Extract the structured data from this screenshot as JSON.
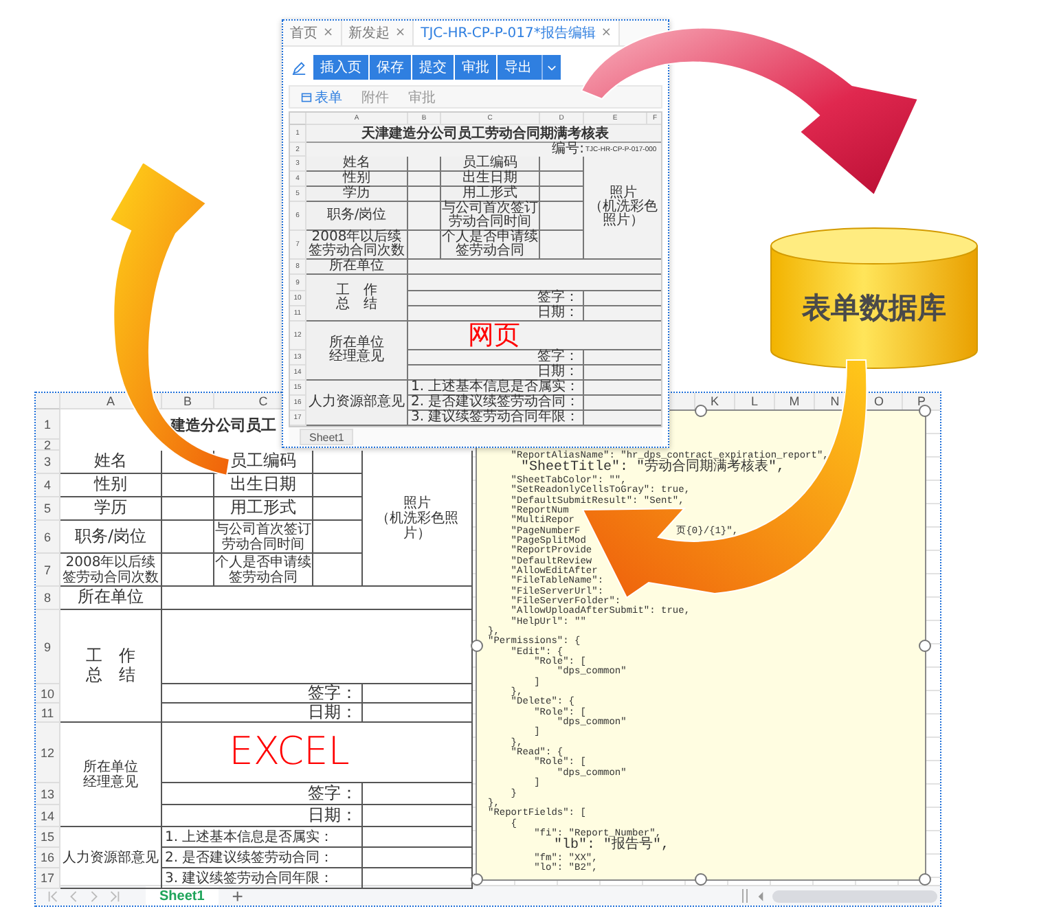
{
  "web_page": {
    "tabs": [
      {
        "label": "首页",
        "close": "×",
        "selected": false
      },
      {
        "label": "新发起",
        "close": "×",
        "selected": false
      },
      {
        "label": "TJC-HR-CP-P-017*报告编辑",
        "close": "×",
        "selected": true
      }
    ],
    "toolbar": [
      {
        "label": "插入页",
        "dropdown": false
      },
      {
        "label": "保存",
        "dropdown": false
      },
      {
        "label": "提交",
        "dropdown": false
      },
      {
        "label": "审批",
        "dropdown": false
      },
      {
        "label": "导出",
        "dropdown": true
      }
    ],
    "subtabs": [
      {
        "label": "表单",
        "selected": true
      },
      {
        "label": "附件",
        "selected": false
      },
      {
        "label": "审批",
        "selected": false
      }
    ],
    "columns": [
      "A",
      "B",
      "C",
      "D",
      "E",
      "F"
    ],
    "row_numbers": [
      "1",
      "2",
      "3",
      "4",
      "5",
      "6",
      "7",
      "8",
      "9",
      "10",
      "11",
      "12",
      "13",
      "14",
      "15",
      "16",
      "17"
    ],
    "form": {
      "title": "天津建造分公司员工劳动合同期满考核表",
      "number_label": "编号:",
      "number": "TJC-HR-CP-P-017-000",
      "photo_lines": [
        "照片",
        "（机洗彩色照片）"
      ],
      "info_rows": [
        {
          "label": "姓名",
          "label2": "员工编码"
        },
        {
          "label": "性别",
          "label2": "出生日期"
        },
        {
          "label": "学历",
          "label2": "用工形式"
        },
        {
          "label": "职务/岗位",
          "label2": "与公司首次签订劳动合同时间"
        },
        {
          "label": "2008年以后续签劳动合同次数",
          "label2": "个人是否申请续签劳动合同"
        }
      ],
      "unit": "所在单位",
      "sections": [
        {
          "label_lines": [
            "工　作",
            "总　结"
          ],
          "sign": "签字：",
          "date": "日期："
        },
        {
          "label_lines": [
            "所在单位",
            "经理意见"
          ],
          "sign": "签字：",
          "date": "日期："
        }
      ],
      "hr": {
        "label": "人力资源部意见",
        "items": [
          "1. 上述基本信息是否属实：",
          "2. 是否建议续签劳动合同：",
          "3. 建议续签劳动合同年限："
        ]
      }
    },
    "overlay_label": "网页",
    "sheet_tabs": [
      {
        "label": "Sheet1"
      }
    ]
  },
  "database": {
    "label": "表单数据库"
  },
  "excel": {
    "columns": [
      "A",
      "B",
      "C"
    ],
    "right_columns": [
      "K",
      "L",
      "M",
      "N",
      "O",
      "P"
    ],
    "row_numbers": [
      "1",
      "2",
      "3",
      "4",
      "5",
      "6",
      "7",
      "8",
      "9",
      "10",
      "11",
      "12",
      "13",
      "14",
      "15",
      "16",
      "17"
    ],
    "form": {
      "title": "建造分公司员工",
      "photo_lines": [
        "照片",
        "（机洗彩色照片）"
      ],
      "info_rows": [
        {
          "label": "姓名",
          "label2": "员工编码"
        },
        {
          "label": "性别",
          "label2": "出生日期"
        },
        {
          "label": "学历",
          "label2": "用工形式"
        },
        {
          "label": "职务/岗位",
          "label2": "与公司首次签订劳动合同时间"
        },
        {
          "label": "2008年以后续签劳动合同次数",
          "label2": "个人是否申请续签劳动合同"
        }
      ],
      "unit": "所在单位",
      "sections": [
        {
          "label_lines": [
            "工　作",
            "总　结"
          ],
          "sign": "签字：",
          "date": "日期："
        },
        {
          "label_lines": [
            "所在单位",
            "经理意见"
          ],
          "sign": "签字：",
          "date": "日期："
        }
      ],
      "hr": {
        "label": "人力资源部意见",
        "items": [
          "1. 上述基本信息是否属实：",
          "2. 是否建议续签劳动合同：",
          "3. 建议续签劳动合同年限："
        ]
      }
    },
    "overlay_label": "EXCEL",
    "code_lines": [
      {
        "text": "    \"ReportAliasName\": \"hr_dps_contract_expiration_report\","
      },
      {
        "text": "    \"SheetTitle\": \"劳动合同期满考核表\","
      },
      {
        "text": "    \"SheetTabColor\": \"\","
      },
      {
        "text": "    \"SetReadonlyCellsToGray\": true,"
      },
      {
        "text": "    \"DefaultSubmitResult\": \"Sent\","
      },
      {
        "text": "    \"ReportNum"
      },
      {
        "text": "    \"MultiRepor"
      },
      {
        "text": "    \"PageNumberF",
        "tail": "页{0}/{1}\","
      },
      {
        "text": "    \"PageSplitMod"
      },
      {
        "text": "    \"ReportProvide"
      },
      {
        "text": "    \"DefaultReview"
      },
      {
        "text": "    \"AllowEditAfter"
      },
      {
        "text": "    \"FileTableName\":"
      },
      {
        "text": "    \"FileServerUrl\":"
      },
      {
        "text": "    \"FileServerFolder\":"
      },
      {
        "text": "    \"AllowUploadAfterSubmit\": true,"
      },
      {
        "text": "    \"HelpUrl\": \"\""
      },
      {
        "text": "},"
      },
      {
        "text": "\"Permissions\": {"
      },
      {
        "text": "    \"Edit\": {"
      },
      {
        "text": "        \"Role\": ["
      },
      {
        "text": "            \"dps_common\""
      },
      {
        "text": "        ]"
      },
      {
        "text": "    },"
      },
      {
        "text": "    \"Delete\": {"
      },
      {
        "text": "        \"Role\": ["
      },
      {
        "text": "            \"dps_common\""
      },
      {
        "text": "        ]"
      },
      {
        "text": "    },"
      },
      {
        "text": "    \"Read\": {"
      },
      {
        "text": "        \"Role\": ["
      },
      {
        "text": "            \"dps_common\""
      },
      {
        "text": "        ]"
      },
      {
        "text": "    }"
      },
      {
        "text": "},"
      },
      {
        "text": "\"ReportFields\": ["
      },
      {
        "text": "    {"
      },
      {
        "text": "        \"fi\": \"Report_Number\","
      },
      {
        "text": "        \"lb\": \"报告号\","
      },
      {
        "text": "        \"fm\": \"XX\","
      },
      {
        "text": "        \"lo\": \"B2\","
      }
    ],
    "sheet_tabs": [
      {
        "label": "Sheet1"
      }
    ],
    "add_sheet": "+"
  }
}
